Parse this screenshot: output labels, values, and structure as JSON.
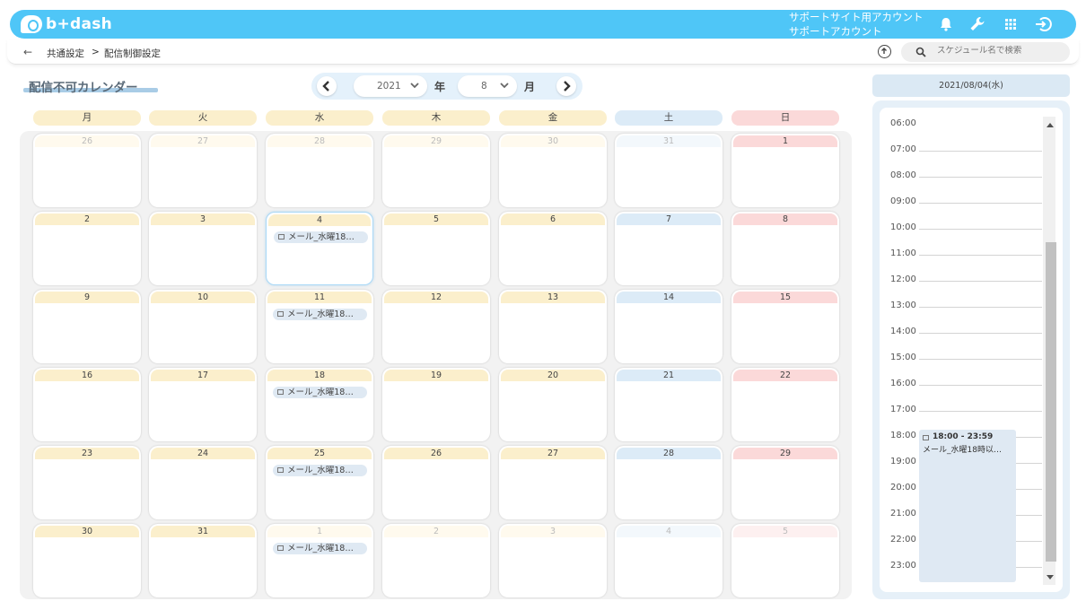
{
  "header": {
    "logo": "b+dash",
    "account_line1": "サポートサイト用アカウント",
    "account_line2": "サポートアカウント",
    "icons": [
      "bell-icon",
      "wrench-icon",
      "grid-icon",
      "logout-icon"
    ]
  },
  "breadcrumb": {
    "back": "←",
    "parent": "共通設定",
    "separator": ">",
    "current": "配信制御設定"
  },
  "search": {
    "placeholder": "スケジュール名で検索"
  },
  "page": {
    "title": "配信不可カレンダー"
  },
  "month_nav": {
    "year_value": "2021",
    "year_unit": "年",
    "month_value": "8",
    "month_unit": "月"
  },
  "calendar": {
    "weekdays": [
      "月",
      "火",
      "水",
      "木",
      "金",
      "土",
      "日"
    ],
    "weeks": [
      [
        {
          "d": "26",
          "dim": true
        },
        {
          "d": "27",
          "dim": true
        },
        {
          "d": "28",
          "dim": true
        },
        {
          "d": "29",
          "dim": true
        },
        {
          "d": "30",
          "dim": true
        },
        {
          "d": "31",
          "dim": true
        },
        {
          "d": "1"
        }
      ],
      [
        {
          "d": "2"
        },
        {
          "d": "3"
        },
        {
          "d": "4",
          "today": true,
          "event": "メール_水曜18…"
        },
        {
          "d": "5"
        },
        {
          "d": "6"
        },
        {
          "d": "7"
        },
        {
          "d": "8"
        }
      ],
      [
        {
          "d": "9"
        },
        {
          "d": "10"
        },
        {
          "d": "11",
          "event": "メール_水曜18…"
        },
        {
          "d": "12"
        },
        {
          "d": "13"
        },
        {
          "d": "14"
        },
        {
          "d": "15"
        }
      ],
      [
        {
          "d": "16"
        },
        {
          "d": "17"
        },
        {
          "d": "18",
          "event": "メール_水曜18…"
        },
        {
          "d": "19"
        },
        {
          "d": "20"
        },
        {
          "d": "21"
        },
        {
          "d": "22"
        }
      ],
      [
        {
          "d": "23"
        },
        {
          "d": "24"
        },
        {
          "d": "25",
          "event": "メール_水曜18…"
        },
        {
          "d": "26"
        },
        {
          "d": "27"
        },
        {
          "d": "28"
        },
        {
          "d": "29"
        }
      ],
      [
        {
          "d": "30"
        },
        {
          "d": "31"
        },
        {
          "d": "1",
          "dim": true,
          "event": "メール_水曜18…"
        },
        {
          "d": "2",
          "dim": true
        },
        {
          "d": "3",
          "dim": true
        },
        {
          "d": "4",
          "dim": true
        },
        {
          "d": "5",
          "dim": true
        }
      ]
    ]
  },
  "day_panel": {
    "date": "2021/08/04(水)",
    "hours": [
      "06:00",
      "07:00",
      "08:00",
      "09:00",
      "10:00",
      "11:00",
      "12:00",
      "13:00",
      "14:00",
      "15:00",
      "16:00",
      "17:00",
      "18:00",
      "19:00",
      "20:00",
      "21:00",
      "22:00",
      "23:00"
    ],
    "event_time": "18:00 - 23:59",
    "event_name": "メール_水曜18時以…"
  }
}
